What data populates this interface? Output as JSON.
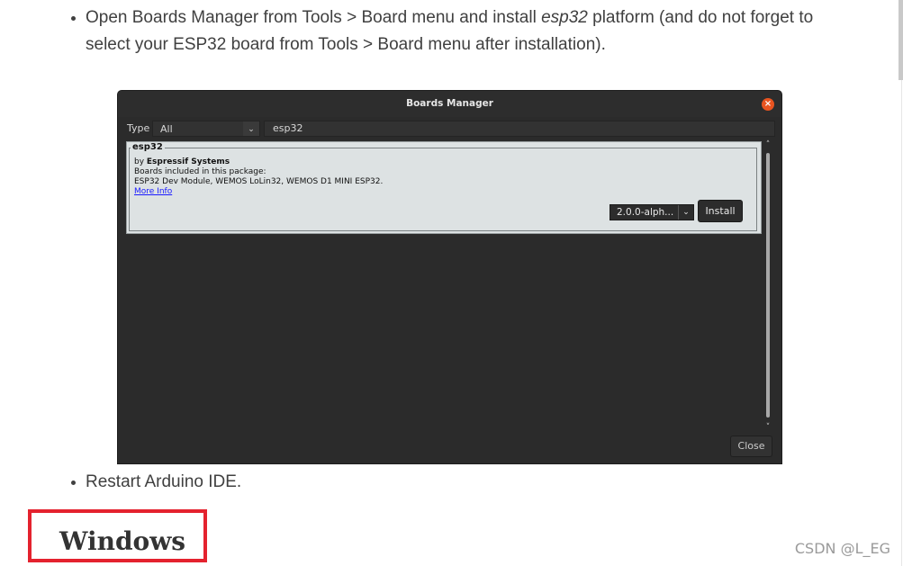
{
  "bullets": {
    "first": {
      "line1_pre": "Open Boards Manager from Tools > Board menu and install ",
      "line1_em": "esp32",
      "line1_post": " platform (and do not forget to",
      "line2": "select your ESP32 board from Tools > Board menu after installation)."
    },
    "second": {
      "text": "Restart Arduino IDE."
    }
  },
  "boards_manager": {
    "title": "Boards Manager",
    "close_x": "×",
    "type_label": "Type",
    "type_value": "All",
    "type_arrow": "⌄",
    "search_value": "esp32",
    "item": {
      "name": "esp32",
      "by_prefix": "by ",
      "vendor": "Espressif Systems",
      "boards_heading": "Boards included in this package:",
      "boards": "ESP32 Dev Module, WEMOS LoLin32, WEMOS D1 MINI ESP32.",
      "more_info": "More Info",
      "version": "2.0.0-alph...",
      "version_arrow": "⌄",
      "install_label": "Install"
    },
    "scroll_up": "˄",
    "scroll_down": "˅",
    "close_label": "Close",
    "accent_close": "#e95420"
  },
  "heading": {
    "windows": "Windows"
  },
  "annotation": {
    "box_color": "#e4222e"
  },
  "watermark": "CSDN @L_EG"
}
